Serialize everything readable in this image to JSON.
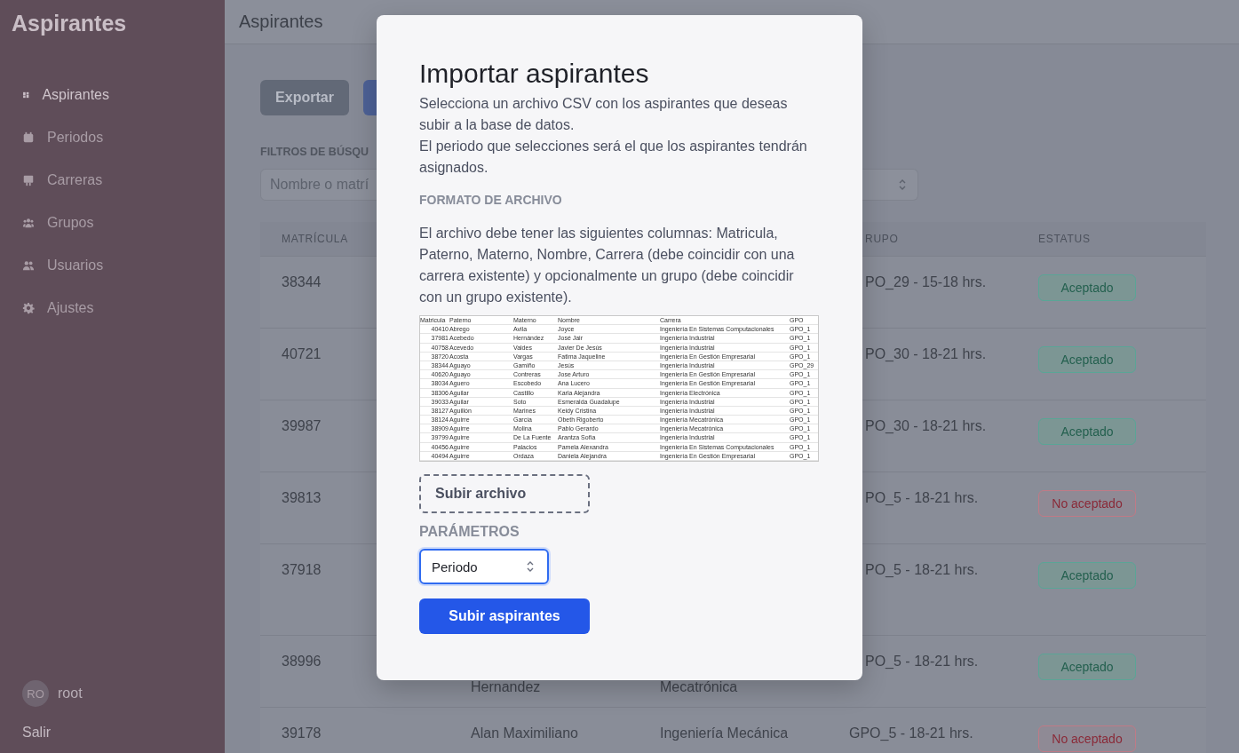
{
  "sidebar": {
    "logo": "Aspirantes",
    "items": [
      {
        "label": "Aspirantes",
        "kind": "dashboard",
        "selected": true
      },
      {
        "label": "Periodos",
        "kind": "calendar",
        "selected": false
      },
      {
        "label": "Carreras",
        "kind": "board",
        "selected": false
      },
      {
        "label": "Grupos",
        "kind": "group",
        "selected": false
      },
      {
        "label": "Usuarios",
        "kind": "users",
        "selected": false
      },
      {
        "label": "Ajustes",
        "kind": "gear",
        "selected": false
      }
    ],
    "user": {
      "initials": "RO",
      "name": "root"
    },
    "logout": "Salir"
  },
  "header": {
    "title": "Aspirantes"
  },
  "toolbar": {
    "export_button": "Exportar"
  },
  "filters": {
    "label": "FILTROS DE BÚSQU",
    "search": {
      "placeholder": "Nombre o matrí"
    }
  },
  "table": {
    "columns": [
      {
        "label": "MATRÍCULA"
      },
      {
        "label": "RUPO"
      },
      {
        "label": "ESTATUS"
      }
    ],
    "rows": [
      {
        "matricula": "38344",
        "grupo": "PO_29 - 15-18 hrs.",
        "status": "Aceptado",
        "accepted": true
      },
      {
        "matricula": "40721",
        "grupo": "PO_30 - 18-21 hrs.",
        "status": "Aceptado",
        "accepted": true
      },
      {
        "matricula": "39987",
        "grupo": "PO_30 - 18-21 hrs.",
        "status": "Aceptado",
        "accepted": true
      },
      {
        "matricula": "39813",
        "grupo": "PO_5 - 18-21 hrs.",
        "status": "No aceptado",
        "accepted": false
      },
      {
        "matricula": "37918",
        "grupo": "PO_5 - 18-21 hrs.",
        "status": "Aceptado",
        "accepted": true
      },
      {
        "matricula": "38996",
        "nombre": "Hernandez",
        "carrera": "Mecatrónica",
        "grupo": "PO_5 - 18-21 hrs.",
        "status": "Aceptado",
        "accepted": true
      },
      {
        "matricula": "39178",
        "nombre": "Alan Maximiliano",
        "carrera": "Ingeniería Mecánica",
        "grupo": "GPO_5 - 18-21 hrs.",
        "status": "No aceptado",
        "accepted": false
      }
    ]
  },
  "modal": {
    "title": "Importar aspirantes",
    "intro": [
      "Selecciona un archivo CSV con los aspirantes que deseas subir a la base de datos.",
      "El periodo que selecciones será el que los aspirantes tendrán asignados."
    ],
    "format_heading": "FORMATO DE ARCHIVO",
    "format_text": "El archivo debe tener las siguientes columnas: Matricula, Paterno, Materno, Nombre, Carrera (debe coincidir con una carrera existente) y opcionalmente un grupo (debe coincidir con un grupo existente).",
    "sample_sheet": {
      "columns": [
        "Matricula",
        "Paterno",
        "Materno",
        "Nombre",
        "Carrera",
        "GPO"
      ],
      "rows": [
        [
          "40410",
          "Abrego",
          "Avila",
          "Joyce",
          "Ingeniería En Sistemas Computacionales",
          "GPO_1"
        ],
        [
          "37981",
          "Acebedo",
          "Hernández",
          "José Jair",
          "Ingeniería Industrial",
          "GPO_1"
        ],
        [
          "40758",
          "Acevedo",
          "Valdes",
          "Javier De Jesús",
          "Ingeniería Industrial",
          "GPO_1"
        ],
        [
          "38720",
          "Acosta",
          "Vargas",
          "Fatima Jaqueline",
          "Ingeniería En Gestión Empresarial",
          "GPO_1"
        ],
        [
          "38344",
          "Aguayo",
          "Gamiño",
          "Jesús",
          "Ingeniería Industrial",
          "GPO_29"
        ],
        [
          "40620",
          "Aguayo",
          "Contreras",
          "Jose Arturo",
          "Ingeniería En Gestión Empresarial",
          "GPO_1"
        ],
        [
          "38034",
          "Aguero",
          "Escobedo",
          "Ana Lucero",
          "Ingeniería En Gestión Empresarial",
          "GPO_1"
        ],
        [
          "38306",
          "Aguilar",
          "Castillo",
          "Karla Alejandra",
          "Ingeniería Electrónica",
          "GPO_1"
        ],
        [
          "39033",
          "Aguilar",
          "Soto",
          "Esmeralda Guadalupe",
          "Ingeniería Industrial",
          "GPO_1"
        ],
        [
          "38127",
          "Aguillón",
          "Marines",
          "Keidy Cristina",
          "Ingeniería Industrial",
          "GPO_1"
        ],
        [
          "38124",
          "Aguirre",
          "García",
          "Obeth Rigoberto",
          "Ingeniería Mecatrónica",
          "GPO_1"
        ],
        [
          "38909",
          "Aguirre",
          "Molina",
          "Pablo Gerardo",
          "Ingeniería Mecatrónica",
          "GPO_1"
        ],
        [
          "39799",
          "Aguirre",
          "De La Fuente",
          "Arantza Sofía",
          "Ingeniería Industrial",
          "GPO_1"
        ],
        [
          "40456",
          "Aguirre",
          "Palacios",
          "Pamela Alexandra",
          "Ingeniería En Sistemas Computacionales",
          "GPO_1"
        ],
        [
          "40494",
          "Aguirre",
          "Ordaza",
          "Daniela Alejandra",
          "Ingeniería En Gestión Empresarial",
          "GPO_1"
        ]
      ]
    },
    "upload_button": "Subir archivo",
    "params_heading": "PARÁMETROS",
    "period_select": {
      "value": "Periodo"
    },
    "submit_button": "Subir aspirantes"
  }
}
